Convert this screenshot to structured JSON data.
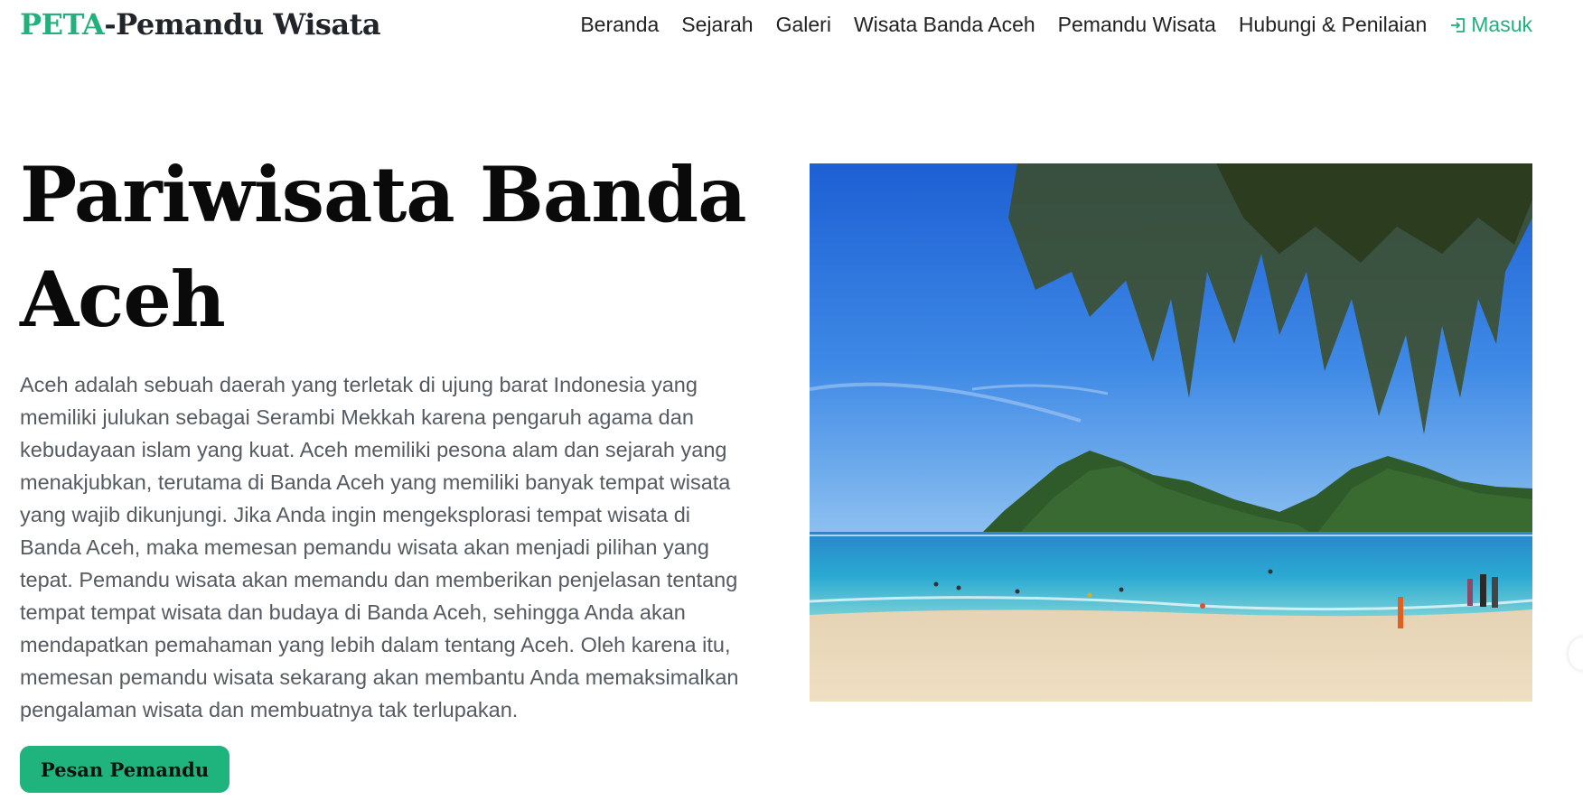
{
  "navbar": {
    "brand_accent": "PETA",
    "brand_rest": "-Pemandu Wisata",
    "links": [
      "Beranda",
      "Sejarah",
      "Galeri",
      "Wisata Banda Aceh",
      "Pemandu Wisata",
      "Hubungi & Penilaian"
    ],
    "login_label": "Masuk",
    "login_icon": "login-icon"
  },
  "hero": {
    "title": "Pariwisata Banda Aceh",
    "description": "Aceh adalah sebuah daerah yang terletak di ujung barat Indonesia yang memiliki julukan sebagai Serambi Mekkah karena pengaruh agama dan kebudayaan islam yang kuat. Aceh memiliki pesona alam dan sejarah yang menakjubkan, terutama di Banda Aceh yang memiliki banyak tempat wisata yang wajib dikunjungi. Jika Anda ingin mengeksplorasi tempat wisata di Banda Aceh, maka memesan pemandu wisata akan menjadi pilihan yang tepat. Pemandu wisata akan memandu dan memberikan penjelasan tentang tempat tempat wisata dan budaya di Banda Aceh, sehingga Anda akan mendapatkan pemahaman yang lebih dalam tentang Aceh. Oleh karena itu, memesan pemandu wisata sekarang akan membantu Anda memaksimalkan pengalaman wisata dan membuatnya tak terlupakan.",
    "cta_label": "Pesan Pemandu"
  },
  "colors": {
    "accent": "#22b07d",
    "button": "#1fb37d",
    "text": "#212529",
    "muted": "#555b61"
  }
}
